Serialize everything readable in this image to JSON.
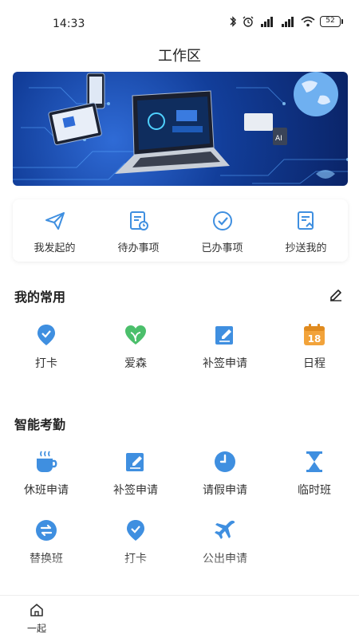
{
  "status": {
    "time": "14:33",
    "battery": "52"
  },
  "page": {
    "title": "工作区"
  },
  "quick_tabs": [
    {
      "label": "我发起的",
      "icon": "paper-plane-icon"
    },
    {
      "label": "待办事项",
      "icon": "pending-doc-icon"
    },
    {
      "label": "已办事项",
      "icon": "check-circle-icon"
    },
    {
      "label": "抄送我的",
      "icon": "cc-doc-icon"
    }
  ],
  "frequent": {
    "title": "我的常用",
    "items": [
      {
        "label": "打卡",
        "icon": "location-check-icon"
      },
      {
        "label": "爱森",
        "icon": "heart-leaf-icon"
      },
      {
        "label": "补签申请",
        "icon": "edit-doc-icon"
      },
      {
        "label": "日程",
        "icon": "calendar-icon",
        "badge": "18"
      }
    ]
  },
  "attendance": {
    "title": "智能考勤",
    "items": [
      {
        "label": "休班申请",
        "icon": "coffee-cup-icon"
      },
      {
        "label": "补签申请",
        "icon": "edit-doc-icon"
      },
      {
        "label": "请假申请",
        "icon": "clock-icon"
      },
      {
        "label": "临时班",
        "icon": "hourglass-icon"
      },
      {
        "label": "替换班",
        "icon": "swap-icon"
      },
      {
        "label": "打卡",
        "icon": "location-check-icon"
      },
      {
        "label": "公出申请",
        "icon": "airplane-icon"
      }
    ]
  },
  "bottom_nav": {
    "label": "一起"
  },
  "colors": {
    "accent": "#3f8fe0",
    "green": "#4bbf6b",
    "orange": "#f2a33a"
  }
}
